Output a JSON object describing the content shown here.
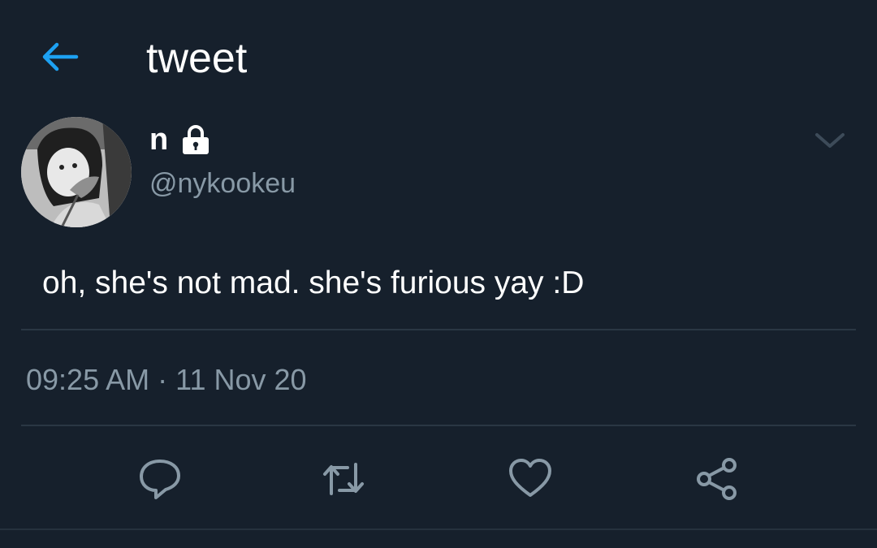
{
  "header": {
    "title": "tweet",
    "back_icon": "back-arrow-icon"
  },
  "colors": {
    "background": "#16202c",
    "accent": "#1da1f2",
    "secondary_text": "#8899a6",
    "divider": "#2a3744"
  },
  "tweet": {
    "display_name": "n",
    "protected_icon": "lock-icon",
    "handle": "@nykookeu",
    "text": "oh, she's not mad. she's furious yay :D",
    "timestamp": "09:25 AM · 11 Nov 20",
    "menu_icon": "chevron-down-icon"
  },
  "actions": [
    {
      "icon": "reply-icon"
    },
    {
      "icon": "retweet-icon"
    },
    {
      "icon": "like-icon"
    },
    {
      "icon": "share-icon"
    }
  ]
}
